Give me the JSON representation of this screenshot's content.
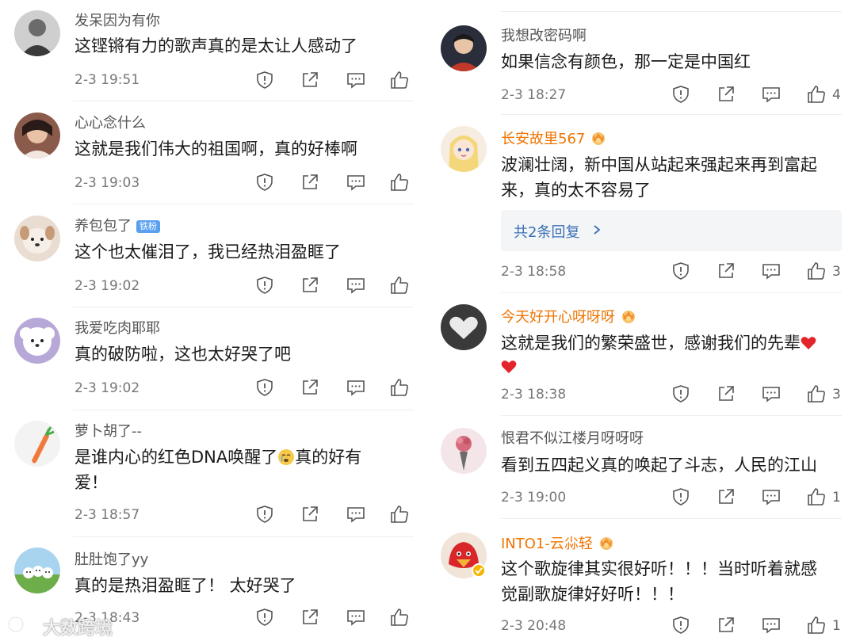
{
  "left_comments": [
    {
      "user": "发呆因为有你",
      "text": "这铿锵有力的歌声真的是太让人感动了",
      "time": "2-3 19:51",
      "likes": ""
    },
    {
      "user": "心心念什么",
      "text": "这就是我们伟大的祖国啊，真的好棒啊",
      "time": "2-3 19:03",
      "likes": ""
    },
    {
      "user": "养包包了",
      "badge": "铁粉",
      "text": "这个也太催泪了，我已经热泪盈眶了",
      "time": "2-3 19:02",
      "likes": ""
    },
    {
      "user": "我爱吃肉耶耶",
      "text": "真的破防啦，这也太好哭了吧",
      "time": "2-3 19:02",
      "likes": ""
    },
    {
      "user": "萝卜胡了--",
      "text_before": "是谁内心的红色DNA唤醒了",
      "text_after": "真的好有",
      "text_line2": "爱！",
      "time": "2-3 18:57",
      "likes": ""
    },
    {
      "user": "肚肚饱了yy",
      "text": "真的是热泪盈眶了！ 太好哭了",
      "time": "2-3 18:43",
      "likes": ""
    }
  ],
  "right_comments": [
    {
      "user": "我想改密码啊",
      "text": "如果信念有颜色，那一定是中国红",
      "time": "2-3 18:27",
      "likes": "4"
    },
    {
      "user": "长安故里567",
      "text": "波澜壮阔，新中国从站起来强起来再到富起",
      "text_line2": "来，真的太不容易了",
      "replies": "共2条回复",
      "time": "2-3 18:58",
      "likes": "3"
    },
    {
      "user": "今天好开心呀呀呀",
      "text": "这就是我们的繁荣盛世，感谢我们的先辈",
      "time": "2-3 18:38",
      "likes": "3"
    },
    {
      "user": "恨君不似江楼月呀呀呀",
      "text": "看到五四起义真的唤起了斗志，人民的江山",
      "time": "2-3 19:00",
      "likes": "1"
    },
    {
      "user": "INTO1-云尛轻",
      "text": "这个歌旋律其实很好听！！！当时听着就感",
      "text_line2": "觉副歌旋律好好听！！！",
      "time": "2-3 20:48",
      "likes": "1"
    }
  ],
  "watermark": "大数跨境",
  "icons": {
    "report": "shield-exclamation-icon",
    "share": "share-arrow-icon",
    "comment": "comment-bubble-icon",
    "like": "thumb-up-icon",
    "vip": "crown-badge-icon"
  },
  "colors": {
    "vip_name": "#f07400",
    "reply_link": "#3a6fb6",
    "fan_badge": "#5aa0f0",
    "meta": "#777777"
  }
}
